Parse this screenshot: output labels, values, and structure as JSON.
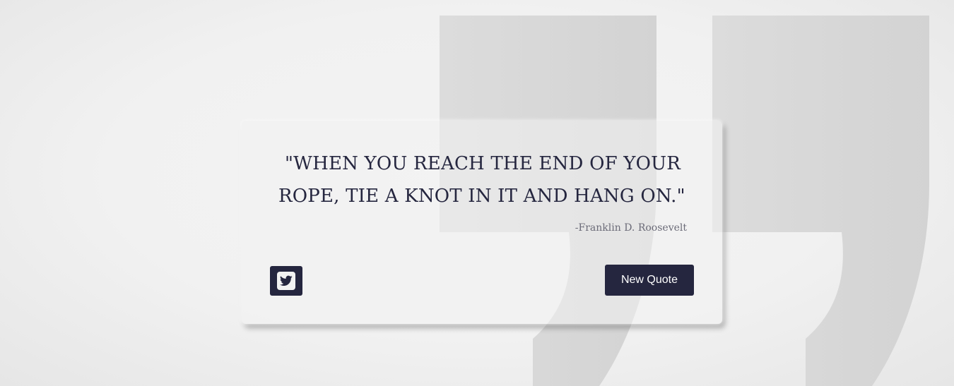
{
  "quote": {
    "text": "\"When you reach the end of your rope, tie a knot in it and hang on.\"",
    "author": "-Franklin D. Roosevelt"
  },
  "actions": {
    "tweet_icon": "twitter-icon",
    "new_quote_label": "New Quote"
  },
  "background": {
    "decoration_icon": "closing-quote-mark-icon"
  },
  "colors": {
    "accent": "#25263f",
    "card": "#f2f2f2",
    "quote_mark": "#cfcfcf",
    "author": "#6b6b78"
  }
}
